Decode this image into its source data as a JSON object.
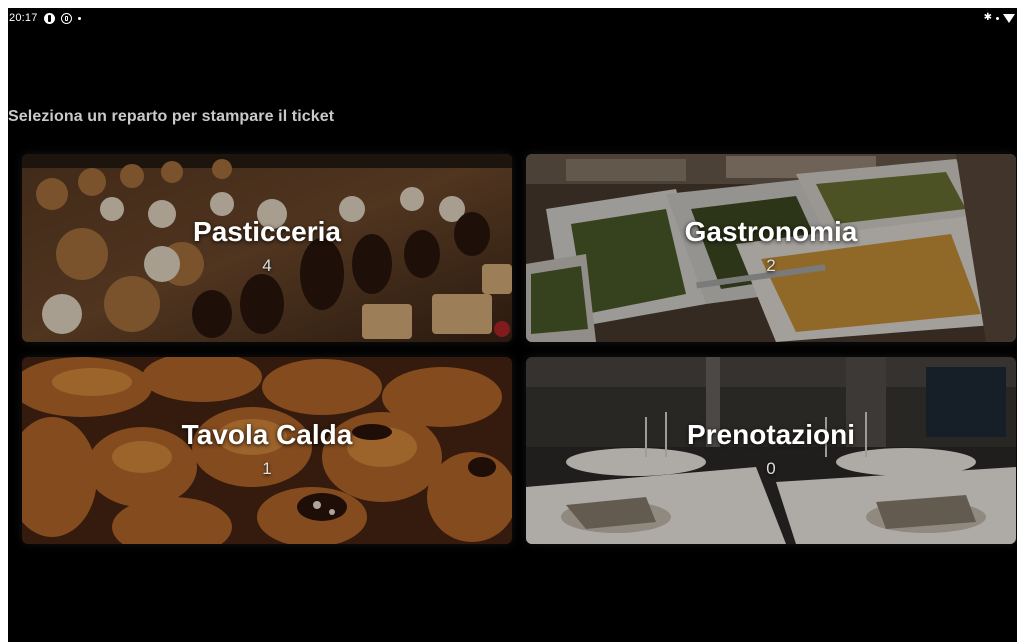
{
  "statusbar": {
    "time": "20:17",
    "icons": [
      "notification-icon",
      "app-icon",
      "dot-icon",
      "bluetooth-icon",
      "wifi-icon"
    ]
  },
  "prompt": "Seleziona un reparto per stampare il ticket",
  "tiles": [
    {
      "name": "Pasticceria",
      "count": "4",
      "icon": "pastry-photo"
    },
    {
      "name": "Gastronomia",
      "count": "2",
      "icon": "deli-photo"
    },
    {
      "name": "Tavola Calda",
      "count": "1",
      "icon": "hot-food-photo"
    },
    {
      "name": "Prenotazioni",
      "count": "0",
      "icon": "restaurant-photo"
    }
  ],
  "colors": {
    "background": "#000000",
    "prompt_text": "#c9c9c9",
    "tile_text": "#ffffff"
  }
}
